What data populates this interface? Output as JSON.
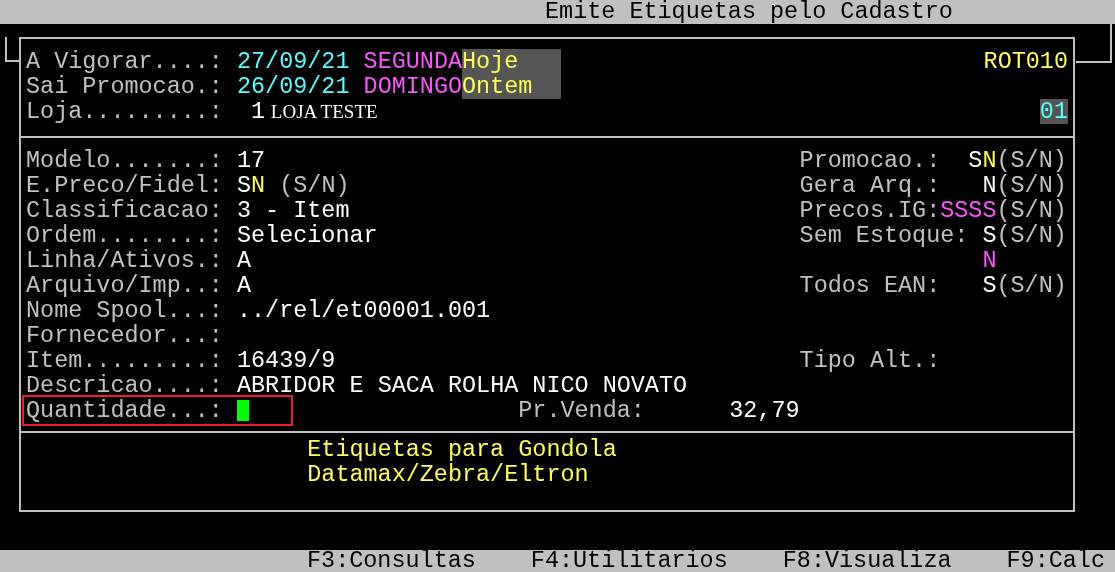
{
  "window": {
    "title": "Emite Etiquetas pelo Cadastro"
  },
  "header": {
    "program": "ROT010",
    "dates": [
      {
        "label": "A Vigorar....:",
        "date": "27/09/21",
        "weekday": "SEGUNDA",
        "relative": "Hoje"
      },
      {
        "label": "Sai Promocao.:",
        "date": "26/09/21",
        "weekday": "DOMINGO",
        "relative": "Ontem"
      }
    ],
    "store": {
      "label": "Loja.........:",
      "number": "1",
      "name": "LOJA TESTE",
      "code": "01"
    }
  },
  "fields": [
    {
      "left": {
        "label": "Modelo.......:",
        "parts": [
          {
            "text": "17",
            "kind": "value"
          }
        ]
      },
      "right": {
        "label": "Promocao.:",
        "parts": [
          {
            "text": "S",
            "kind": "value"
          },
          {
            "text": "N",
            "kind": "highlight"
          },
          {
            "text": "(S/N)",
            "kind": "hint"
          }
        ]
      }
    },
    {
      "left": {
        "label": "E.Preco/Fidel:",
        "parts": [
          {
            "text": "S",
            "kind": "value"
          },
          {
            "text": "N",
            "kind": "highlight"
          },
          {
            "text": "(S/N)",
            "kind": "hint"
          }
        ]
      },
      "right": {
        "label": "Gera Arq.:",
        "parts": [
          {
            "text": "N",
            "kind": "value"
          },
          {
            "text": "(S/N)",
            "kind": "hint"
          }
        ]
      }
    },
    {
      "left": {
        "label": "Classificacao:",
        "parts": [
          {
            "text": "3 - Item",
            "kind": "value"
          }
        ]
      },
      "right": {
        "label": "Precos.IG:",
        "parts": [
          {
            "text": "SSSS",
            "kind": "accent"
          },
          {
            "text": "(S/N)",
            "kind": "hint"
          }
        ]
      }
    },
    {
      "left": {
        "label": "Ordem........:",
        "parts": [
          {
            "text": "Selecionar",
            "kind": "value"
          }
        ]
      },
      "right": {
        "label": "Sem Estoque:",
        "parts": [
          {
            "text": "S",
            "kind": "value"
          },
          {
            "text": "(S/N)",
            "kind": "hint"
          }
        ]
      }
    },
    {
      "left": {
        "label": "Linha/Ativos.:",
        "parts": [
          {
            "text": "A",
            "kind": "value"
          }
        ]
      },
      "right": {
        "parts": [
          {
            "text": "N",
            "kind": "accent"
          }
        ]
      }
    },
    {
      "left": {
        "label": "Arquivo/Imp..:",
        "parts": [
          {
            "text": "A",
            "kind": "value"
          }
        ]
      },
      "right": {
        "label": "Todos EAN:",
        "parts": [
          {
            "text": "S",
            "kind": "value"
          },
          {
            "text": "(S/N)",
            "kind": "hint"
          }
        ]
      }
    },
    {
      "left": {
        "label": "Nome Spool...:",
        "parts": [
          {
            "text": "../rel/et00001.001",
            "kind": "value"
          }
        ]
      }
    },
    {
      "left": {
        "label": "Fornecedor...:"
      }
    },
    {
      "left": {
        "label": "Item.........:",
        "parts": [
          {
            "text": "16439/9",
            "kind": "value"
          }
        ]
      },
      "right": {
        "label": "Tipo Alt.:"
      }
    },
    {
      "left": {
        "label": "Descricao....:",
        "parts": [
          {
            "text": "ABRIDOR E SACA ROLHA NICO NOVATO",
            "kind": "value"
          }
        ]
      }
    }
  ],
  "quantity": {
    "label": "Quantidade...:",
    "focused": true,
    "annotated": true,
    "price_label": "Pr.Venda:",
    "price": "32,79"
  },
  "info": [
    "Etiquetas para Gondola",
    "Datamax/Zebra/Eltron"
  ],
  "function_keys": [
    "F3:Consultas",
    "F4:Utilitarios",
    "F8:Visualiza",
    "F9:Calc"
  ]
}
